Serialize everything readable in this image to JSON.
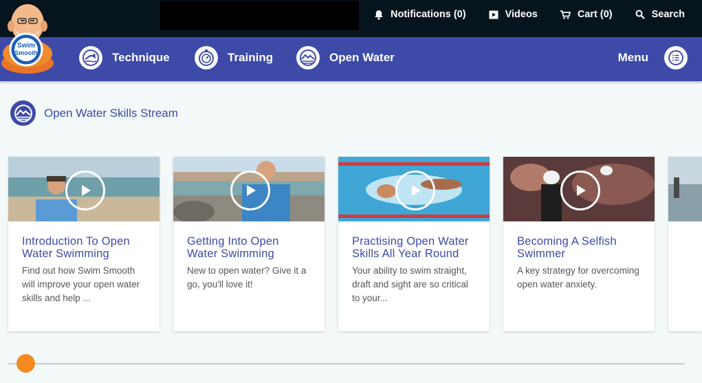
{
  "topbar": {
    "links": [
      {
        "label": "Notifications (0)",
        "icon": "bell-icon"
      },
      {
        "label": "Videos",
        "icon": "video-icon"
      },
      {
        "label": "Cart (0)",
        "icon": "cart-icon"
      },
      {
        "label": "Search",
        "icon": "search-icon"
      }
    ]
  },
  "logo": {
    "text_top": "Swim",
    "text_bottom": "Smooth"
  },
  "nav": {
    "items": [
      {
        "label": "Technique",
        "icon": "technique-icon"
      },
      {
        "label": "Training",
        "icon": "training-icon"
      },
      {
        "label": "Open Water",
        "icon": "open-water-icon"
      }
    ],
    "menu_label": "Menu"
  },
  "stream": {
    "title": "Open Water Skills Stream"
  },
  "cards": [
    {
      "title": "Introduction To Open Water Swimming",
      "description": "Find out how Swim Smooth will improve your open water skills and help ..."
    },
    {
      "title": "Getting Into Open Water Swimming",
      "description": "New to open water? Give it a go, you'll love it!"
    },
    {
      "title": "Practising Open Water Skills All Year Round",
      "description": "Your ability to swim straight, draft and sight are so critical to your..."
    },
    {
      "title": "Becoming A Selfish Swimmer",
      "description": "A key strategy for overcoming open water anxiety."
    }
  ],
  "colors": {
    "brand": "#3e4aa8",
    "topbar": "#06141e",
    "accent": "#f58a1f",
    "background": "#f3f9f8"
  },
  "slider": {
    "position_fraction": 0.02
  }
}
